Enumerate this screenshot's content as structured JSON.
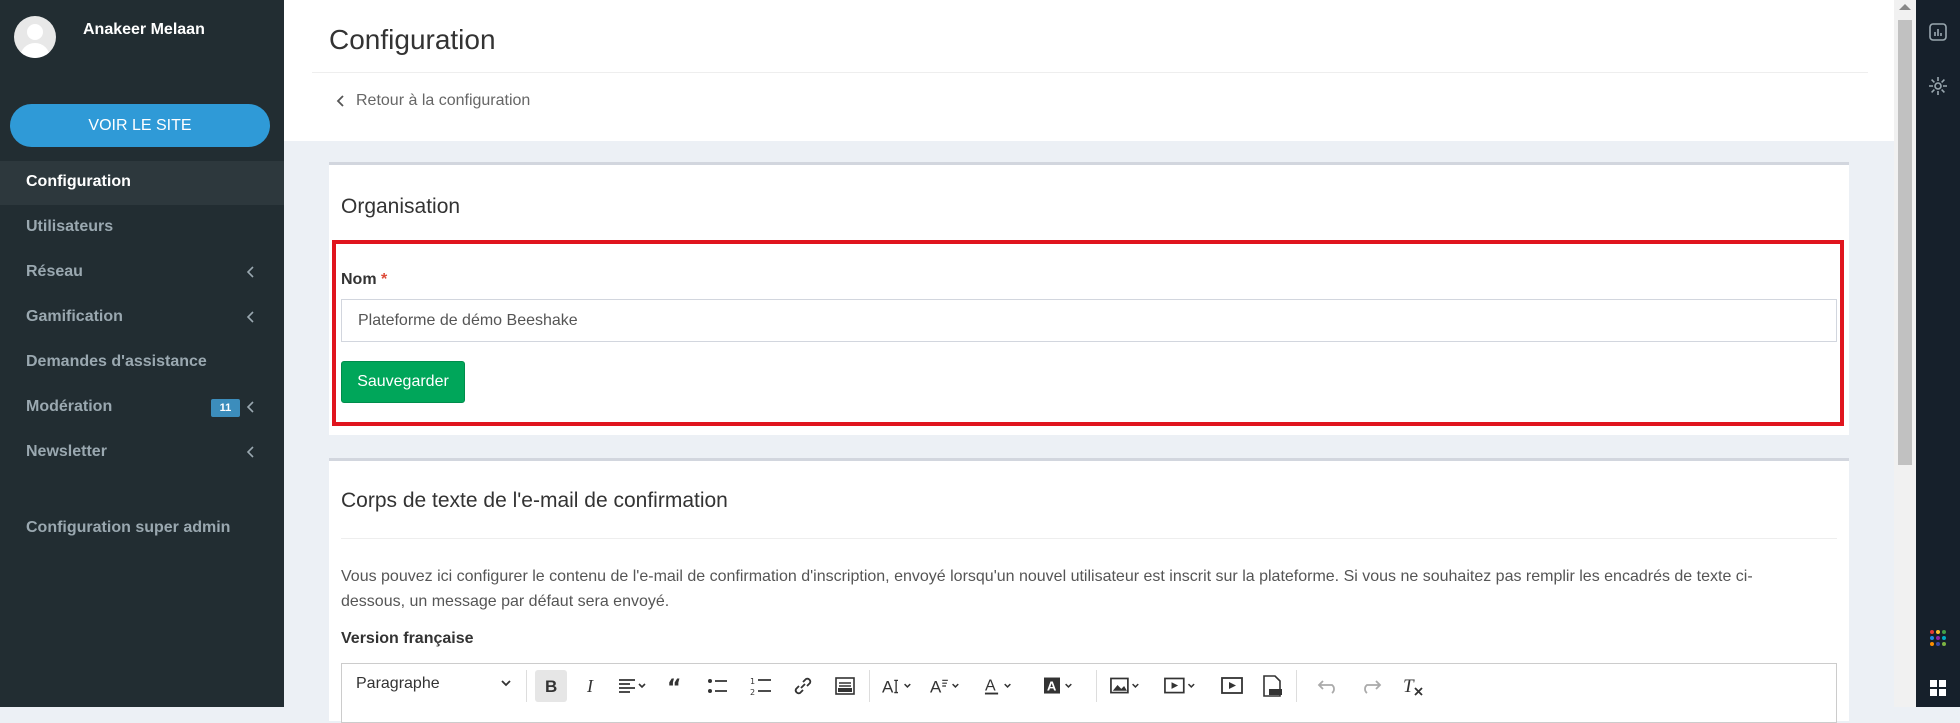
{
  "user": {
    "name": "Anakeer Melaan"
  },
  "sidebar": {
    "visit_button": "VOIR LE SITE",
    "items": [
      {
        "label": "Configuration",
        "active": true
      },
      {
        "label": "Utilisateurs"
      },
      {
        "label": "Réseau",
        "has_submenu": true
      },
      {
        "label": "Gamification",
        "has_submenu": true
      },
      {
        "label": "Demandes d'assistance"
      },
      {
        "label": "Modération",
        "badge": "11",
        "has_submenu": true
      },
      {
        "label": "Newsletter",
        "has_submenu": true
      },
      {
        "label": "Configuration super admin"
      }
    ]
  },
  "header": {
    "title": "Configuration",
    "back_link": "Retour à la configuration"
  },
  "organisation": {
    "title": "Organisation",
    "name_label": "Nom",
    "required_mark": "*",
    "name_value": "Plateforme de démo Beeshake",
    "save_label": "Sauvegarder"
  },
  "email_section": {
    "title": "Corps de texte de l'e-mail de confirmation",
    "description_line1": "Vous pouvez ici configurer le contenu de l'e-mail de confirmation d'inscription, envoyé lorsqu'un nouvel utilisateur est inscrit sur la plateforme. Si vous ne souhaitez pas remplir les encadrés de texte ci-",
    "description_line2": "dessous, un message par défaut sera envoyé.",
    "version_label": "Version française",
    "editor": {
      "paragraph_select": "Paragraphe",
      "buttons": [
        "bold-icon",
        "italic-icon",
        "align-icon",
        "blockquote-icon",
        "bulleted-list-icon",
        "numbered-list-icon",
        "link-icon",
        "html-icon",
        "font-size-icon",
        "font-family-icon",
        "font-color-icon",
        "background-color-icon",
        "image-icon",
        "media-icon",
        "video-icon",
        "pdf-icon",
        "undo-icon",
        "redo-icon",
        "clear-format-icon"
      ]
    }
  },
  "colors": {
    "sidebar_bg": "#222d32",
    "accent_blue": "#2f9ad7",
    "save_green": "#00a65a",
    "highlight_red": "#e0151e",
    "badge_blue": "#3c8dbc"
  }
}
